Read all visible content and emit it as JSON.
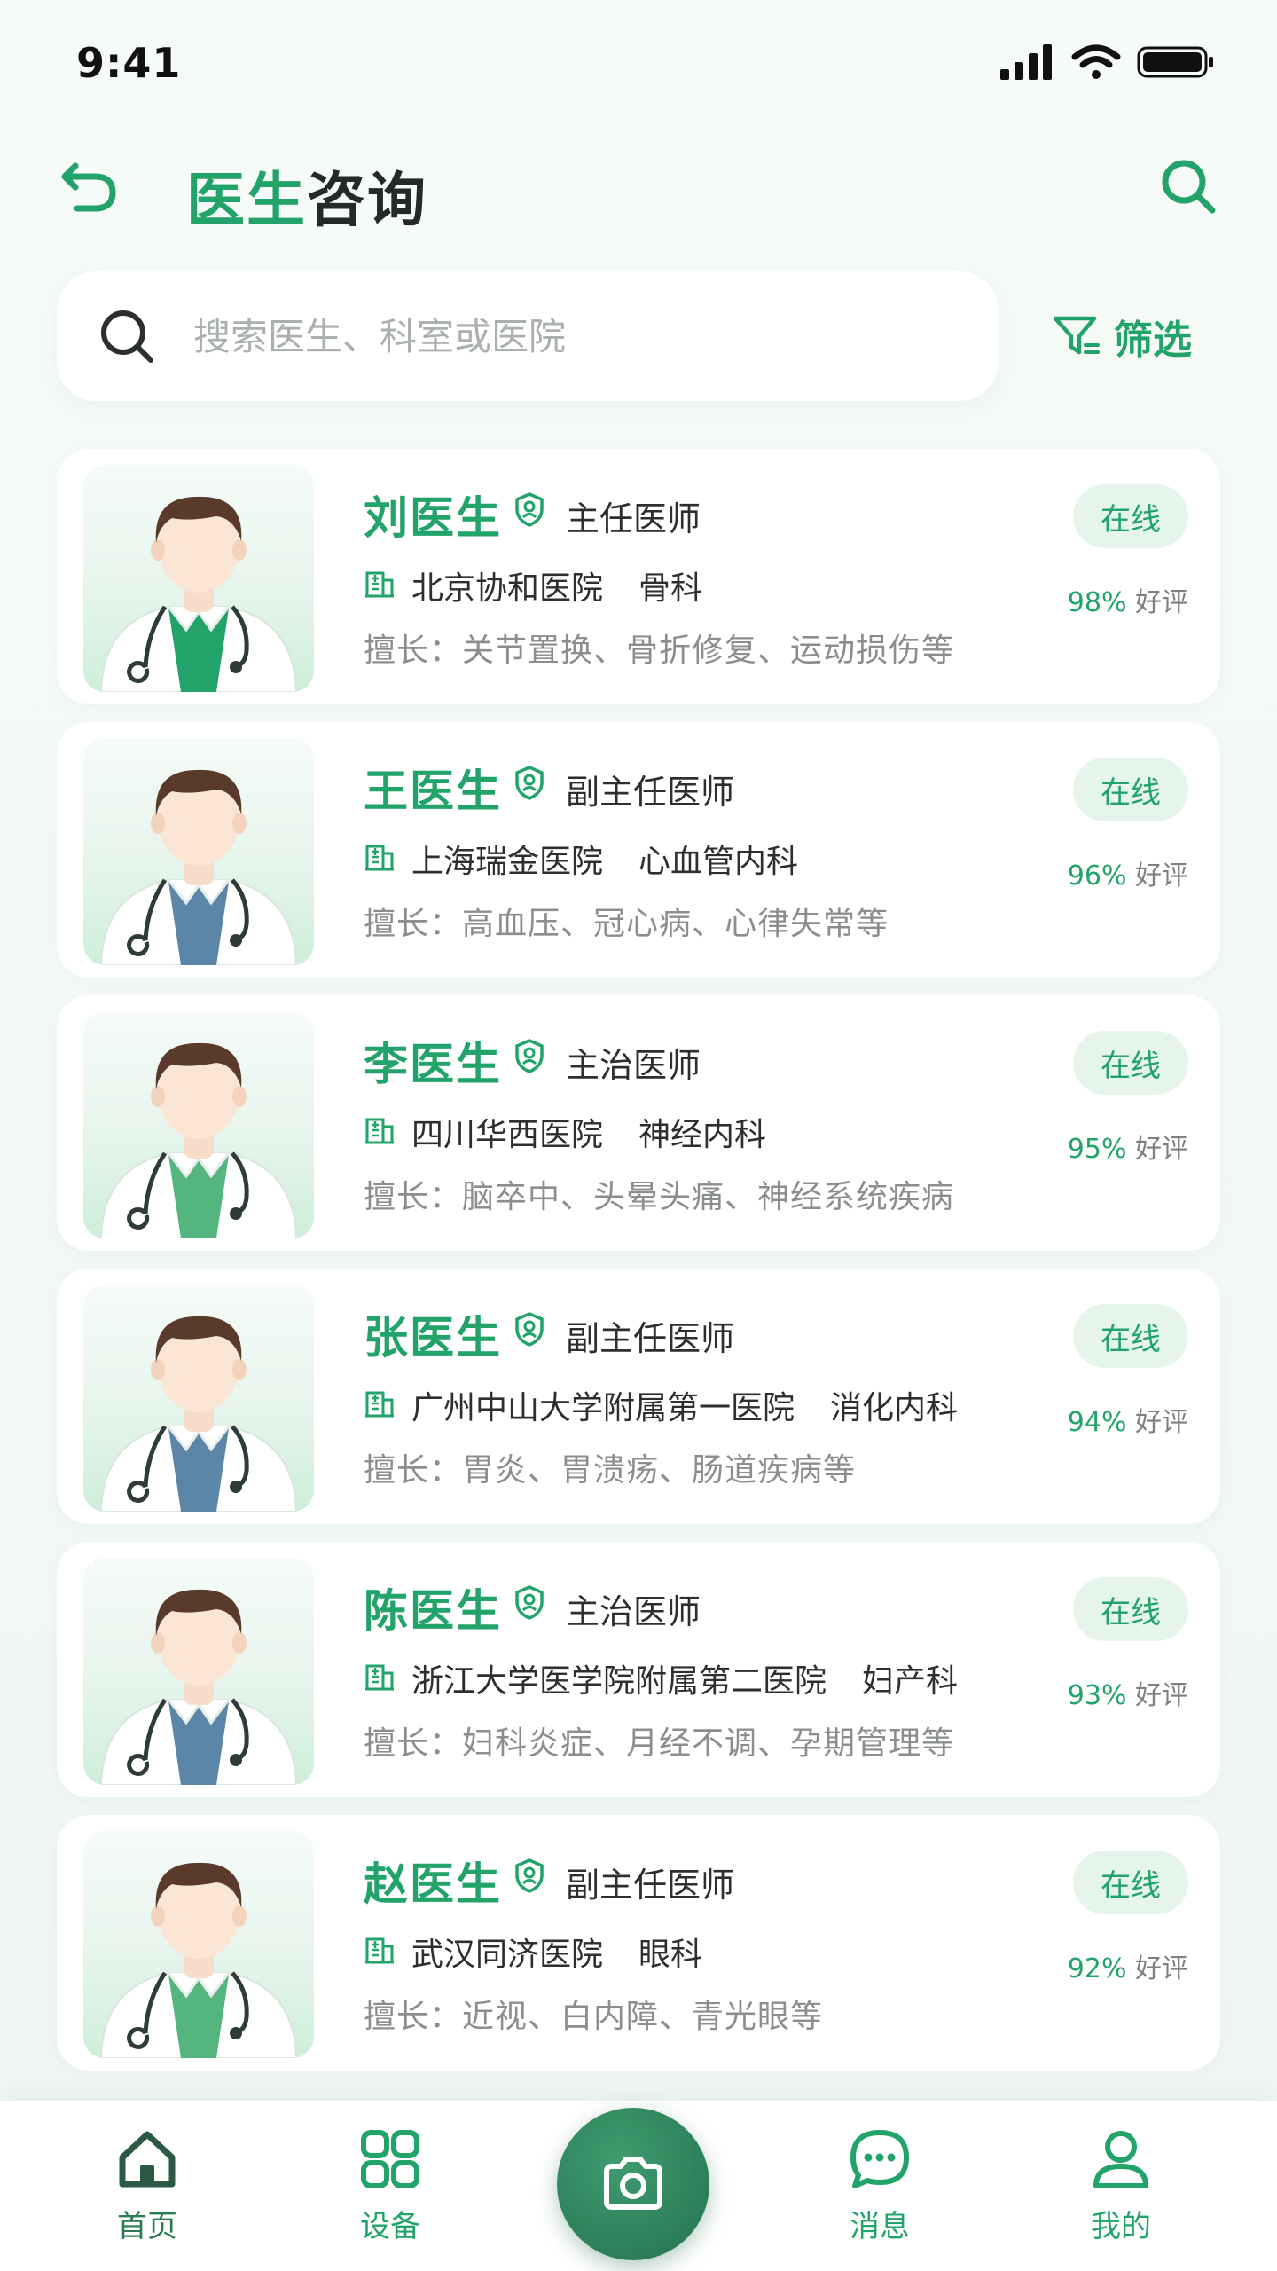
{
  "status_bar": {
    "time": "9:41"
  },
  "header": {
    "title_accent": "医生",
    "title_rest": "咨询"
  },
  "search": {
    "placeholder": "搜索医生、科室或医院",
    "filter_label": "筛选"
  },
  "doctors": [
    {
      "name": "刘医生",
      "title": "主任医师",
      "hospital": "北京协和医院",
      "dept": "骨科",
      "specialty": "擅长：关节置换、骨折修复、运动损伤等",
      "status": "在线",
      "rating_pct": "98%",
      "rating_label": "好评",
      "shirt_color": "#22a36a"
    },
    {
      "name": "王医生",
      "title": "副主任医师",
      "hospital": "上海瑞金医院",
      "dept": "心血管内科",
      "specialty": "擅长：高血压、冠心病、心律失常等",
      "status": "在线",
      "rating_pct": "96%",
      "rating_label": "好评",
      "shirt_color": "#5b86a8"
    },
    {
      "name": "李医生",
      "title": "主治医师",
      "hospital": "四川华西医院",
      "dept": "神经内科",
      "specialty": "擅长：脑卒中、头晕头痛、神经系统疾病",
      "status": "在线",
      "rating_pct": "95%",
      "rating_label": "好评",
      "shirt_color": "#55b57f"
    },
    {
      "name": "张医生",
      "title": "副主任医师",
      "hospital": "广州中山大学附属第一医院",
      "dept": "消化内科",
      "specialty": "擅长：胃炎、胃溃疡、肠道疾病等",
      "status": "在线",
      "rating_pct": "94%",
      "rating_label": "好评",
      "shirt_color": "#5b86a8"
    },
    {
      "name": "陈医生",
      "title": "主治医师",
      "hospital": "浙江大学医学院附属第二医院",
      "dept": "妇产科",
      "specialty": "擅长：妇科炎症、月经不调、孕期管理等",
      "status": "在线",
      "rating_pct": "93%",
      "rating_label": "好评",
      "shirt_color": "#5b86a8"
    },
    {
      "name": "赵医生",
      "title": "副主任医师",
      "hospital": "武汉同济医院",
      "dept": "眼科",
      "specialty": "擅长：近视、白内障、青光眼等",
      "status": "在线",
      "rating_pct": "92%",
      "rating_label": "好评",
      "shirt_color": "#55b57f"
    }
  ],
  "bottom_nav": [
    {
      "label": "首页",
      "icon": "home-icon"
    },
    {
      "label": "设备",
      "icon": "grid-icon"
    },
    {
      "label": "消息",
      "icon": "chat-icon"
    },
    {
      "label": "我的",
      "icon": "user-icon"
    }
  ],
  "camera": {
    "icon": "camera-icon"
  },
  "colors": {
    "accent": "#22a36a",
    "accent_dark": "#2d7f57",
    "pill_bg": "#e6f5ec"
  }
}
